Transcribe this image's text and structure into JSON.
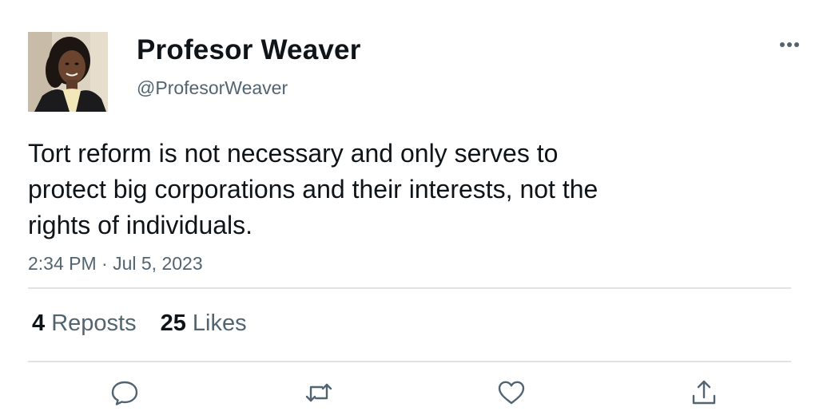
{
  "author": {
    "display_name": "Profesor Weaver",
    "handle": "@ProfesorWeaver",
    "avatar_icon": "profile-photo"
  },
  "tweet": {
    "text_lines": [
      "Tort reform is not necessary and only serves to",
      "protect big corporations and their interests, not the",
      "rights of individuals."
    ],
    "timestamp": "2:34 PM · Jul 5, 2023"
  },
  "stats": {
    "reposts_count": "4",
    "reposts_label": "Reposts",
    "likes_count": "25",
    "likes_label": "Likes"
  },
  "actions": [
    {
      "name": "reply",
      "icon": "speech-bubble-icon"
    },
    {
      "name": "repost",
      "icon": "repost-arrows-icon"
    },
    {
      "name": "like",
      "icon": "heart-icon"
    },
    {
      "name": "share",
      "icon": "share-upload-icon"
    }
  ],
  "colors": {
    "text_primary": "#0f1419",
    "text_secondary": "#536471",
    "divider": "#dfe3e6",
    "icon": "#536471"
  }
}
